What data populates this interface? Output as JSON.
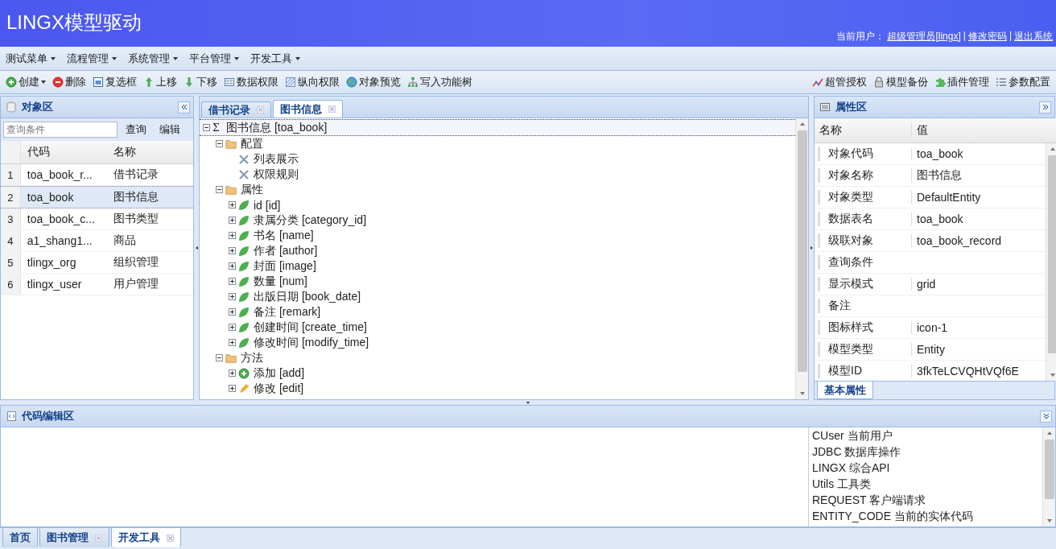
{
  "header": {
    "title": "LINGX模型驱动",
    "user_label": "当前用户：",
    "user_link": "超级管理员[lingx]",
    "links": [
      {
        "separator": "|",
        "label": "修改密码"
      },
      {
        "separator": "|",
        "label": "退出系统"
      }
    ]
  },
  "menu": [
    {
      "label": "测试菜单"
    },
    {
      "label": "流程管理"
    },
    {
      "label": "系统管理"
    },
    {
      "label": "平台管理"
    },
    {
      "label": "开发工具"
    }
  ],
  "toolbar": {
    "left": [
      {
        "label": "创建",
        "kind": "add",
        "dropdown": true
      },
      {
        "label": "删除",
        "kind": "remove",
        "dropdown": false
      },
      {
        "label": "复选框",
        "kind": "checkbox",
        "dropdown": false
      },
      {
        "label": "上移",
        "kind": "up",
        "dropdown": false
      },
      {
        "label": "下移",
        "kind": "down",
        "dropdown": false
      },
      {
        "label": "数据权限",
        "kind": "grid",
        "dropdown": false
      },
      {
        "label": "纵向权限",
        "kind": "hatch",
        "dropdown": false
      },
      {
        "label": "对象预览",
        "kind": "globe",
        "dropdown": false
      },
      {
        "label": "写入功能树",
        "kind": "tree",
        "dropdown": false
      }
    ],
    "right": [
      {
        "label": "超管授权",
        "kind": "chart",
        "dropdown": false
      },
      {
        "label": "模型备份",
        "kind": "lock",
        "dropdown": false
      },
      {
        "label": "插件管理",
        "kind": "puzzle",
        "dropdown": false
      },
      {
        "label": "参数配置",
        "kind": "list",
        "dropdown": false
      }
    ]
  },
  "object_panel": {
    "title": "对象区",
    "search": {
      "placeholder": "查询条件"
    },
    "buttons": [
      "查询",
      "编辑"
    ],
    "columns": [
      "代码",
      "名称"
    ],
    "rows": [
      {
        "index": "1",
        "code": "toa_book_r...",
        "name": "借书记录",
        "selected": false
      },
      {
        "index": "2",
        "code": "toa_book",
        "name": "图书信息",
        "selected": true
      },
      {
        "index": "3",
        "code": "toa_book_c...",
        "name": "图书类型",
        "selected": false
      },
      {
        "index": "4",
        "code": "a1_shang1...",
        "name": "商品",
        "selected": false
      },
      {
        "index": "5",
        "code": "tlingx_org",
        "name": "组织管理",
        "selected": false
      },
      {
        "index": "6",
        "code": "tlingx_user",
        "name": "用户管理",
        "selected": false
      }
    ]
  },
  "center_tabs": [
    {
      "label": "借书记录",
      "selected": false
    },
    {
      "label": "图书信息",
      "selected": true
    }
  ],
  "tree": [
    {
      "label": "图书信息 [toa_book]",
      "symbol": "Σ",
      "expanded": true,
      "selected": true,
      "children": [
        {
          "label": "配置",
          "kind": "folder",
          "expanded": true,
          "selected": false,
          "children": [
            {
              "label": "列表展示",
              "kind": "tool",
              "selected": false
            },
            {
              "label": "权限规则",
              "kind": "tool",
              "selected": false
            }
          ]
        },
        {
          "label": "属性",
          "kind": "folder",
          "expanded": true,
          "selected": false,
          "children": [
            {
              "label": "id [id]",
              "kind": "field",
              "expanded": false,
              "selected": false
            },
            {
              "label": "隶属分类 [category_id]",
              "kind": "field",
              "expanded": false,
              "selected": false
            },
            {
              "label": "书名 [name]",
              "kind": "field",
              "expanded": false,
              "selected": false
            },
            {
              "label": "作者 [author]",
              "kind": "field",
              "expanded": false,
              "selected": false
            },
            {
              "label": "封面 [image]",
              "kind": "field",
              "expanded": false,
              "selected": false
            },
            {
              "label": "数量 [num]",
              "kind": "field",
              "expanded": false,
              "selected": false
            },
            {
              "label": "出版日期 [book_date]",
              "kind": "field",
              "expanded": false,
              "selected": false
            },
            {
              "label": "备注 [remark]",
              "kind": "field",
              "expanded": false,
              "selected": false
            },
            {
              "label": "创建时间 [create_time]",
              "kind": "field",
              "expanded": false,
              "selected": false
            },
            {
              "label": "修改时间 [modify_time]",
              "kind": "field",
              "expanded": false,
              "selected": false
            }
          ]
        },
        {
          "label": "方法",
          "kind": "folder",
          "expanded": true,
          "selected": false,
          "children": [
            {
              "label": "添加 [add]",
              "kind": "add",
              "expanded": false,
              "selected": false
            },
            {
              "label": "修改 [edit]",
              "kind": "edit",
              "expanded": false,
              "selected": false
            }
          ]
        }
      ]
    }
  ],
  "property_panel": {
    "title": "属性区",
    "columns": [
      "名称",
      "值"
    ],
    "rows": [
      {
        "name": "对象代码",
        "value": "toa_book"
      },
      {
        "name": "对象名称",
        "value": "图书信息"
      },
      {
        "name": "对象类型",
        "value": "DefaultEntity"
      },
      {
        "name": "数据表名",
        "value": "toa_book"
      },
      {
        "name": "级联对象",
        "value": "toa_book_record"
      },
      {
        "name": "查询条件"
      },
      {
        "name": "显示模式",
        "value": "grid"
      },
      {
        "name": "备注"
      },
      {
        "name": "图标样式",
        "value": "icon-1"
      },
      {
        "name": "模型类型",
        "value": "Entity"
      },
      {
        "name": "模型ID",
        "value": "3fkTeLCVQHtVQf6E"
      }
    ],
    "tabs": [
      {
        "label": "基本属性",
        "selected": true
      }
    ]
  },
  "code_panel": {
    "title": "代码编辑区",
    "api_list": [
      "CUser 当前用户",
      "JDBC 数据库操作",
      "LINGX 综合API",
      "Utils 工具类",
      "REQUEST 客户端请求",
      "ENTITY_CODE 当前的实体代码"
    ]
  },
  "bottom_tabs": [
    {
      "label": "首页",
      "selected": false,
      "closable": false
    },
    {
      "label": "图书管理",
      "selected": false,
      "closable": true
    },
    {
      "label": "开发工具",
      "selected": true,
      "closable": true
    }
  ]
}
